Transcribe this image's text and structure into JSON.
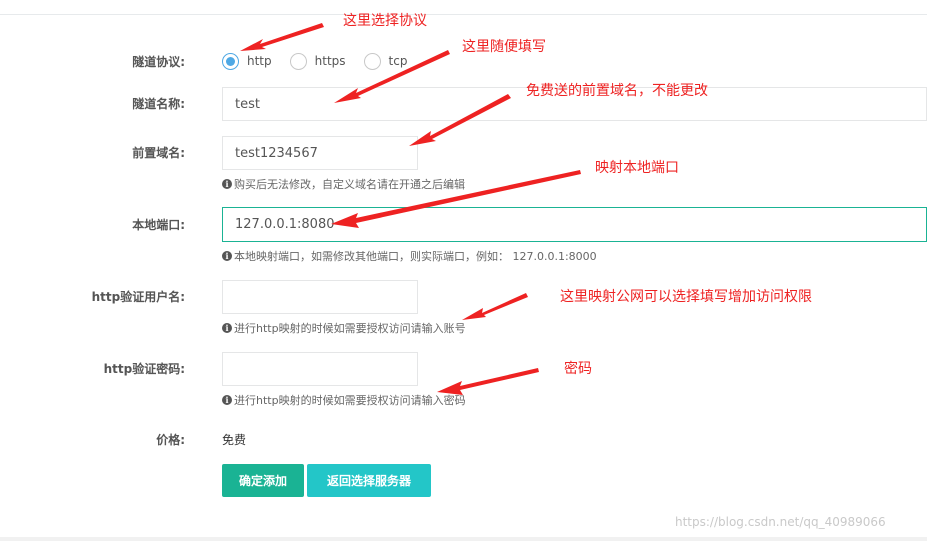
{
  "form": {
    "protocol": {
      "label": "隧道协议:",
      "options": [
        "http",
        "https",
        "tcp"
      ],
      "selected": "http"
    },
    "tunnel_name": {
      "label": "隧道名称:",
      "value": "test"
    },
    "prefix_domain": {
      "label": "前置域名:",
      "value": "test1234567",
      "help": "购买后无法修改，自定义域名请在开通之后编辑"
    },
    "local_port": {
      "label": "本地端口:",
      "value": "127.0.0.1:8080",
      "help": "本地映射端口，如需修改其他端口，则实际端口，例如： 127.0.0.1:8000"
    },
    "http_user": {
      "label": "http验证用户名:",
      "value": "",
      "help": "进行http映射的时候如需要授权访问请输入账号"
    },
    "http_password": {
      "label": "http验证密码:",
      "value": "",
      "help": "进行http映射的时候如需要授权访问请输入密码"
    },
    "price": {
      "label": "价格:",
      "value": "免费"
    },
    "info_icon_glyph": "i"
  },
  "buttons": {
    "confirm_add": "确定添加",
    "back_select_server": "返回选择服务器"
  },
  "annotations": {
    "a1": "这里选择协议",
    "a2": "这里随便填写",
    "a3": "免费送的前置域名，不能更改",
    "a4": "映射本地端口",
    "a5": "这里映射公网可以选择填写增加访问权限",
    "a6": "密码"
  },
  "watermark": "https://blog.csdn.net/qq_40989066",
  "colors": {
    "primary": "#1ab394",
    "info": "#23c6c8",
    "radio_checked": "#4ea8e4",
    "annotation": "#ee2222"
  }
}
